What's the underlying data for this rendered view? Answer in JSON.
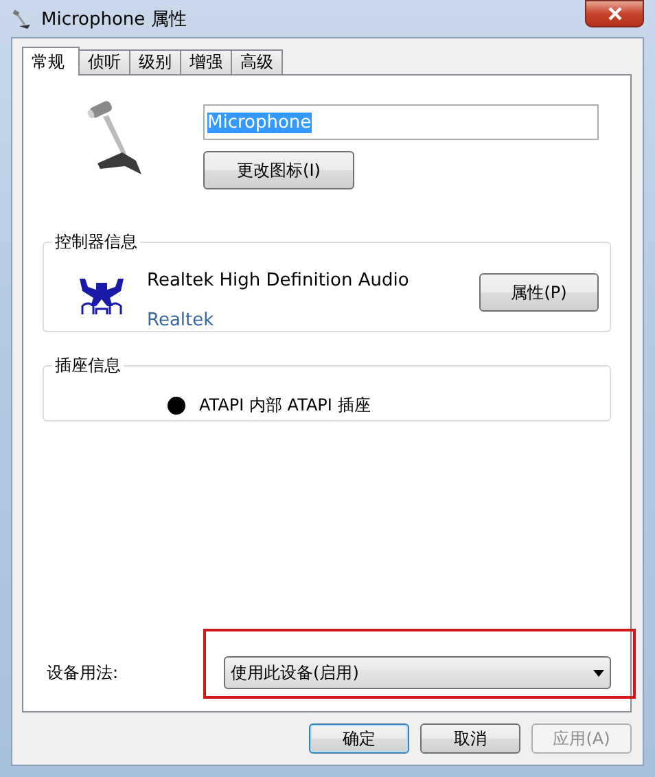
{
  "window": {
    "title": "Microphone 属性"
  },
  "tabs": [
    {
      "label": "常规",
      "selected": true
    },
    {
      "label": "侦听",
      "selected": false
    },
    {
      "label": "级别",
      "selected": false
    },
    {
      "label": "增强",
      "selected": false
    },
    {
      "label": "高级",
      "selected": false
    }
  ],
  "name_field": {
    "value": "Microphone",
    "text_selected": true
  },
  "change_icon_button": "更改图标(I)",
  "controller_info": {
    "heading": "控制器信息",
    "device": "Realtek High Definition Audio",
    "vendor_link": "Realtek",
    "properties_button": "属性(P)"
  },
  "jack_info": {
    "heading": "插座信息",
    "jack": "ATAPI 内部 ATAPI 插座"
  },
  "device_usage": {
    "label": "设备用法:",
    "value": "使用此设备(启用)"
  },
  "buttons": [
    {
      "label": "确定",
      "default": true,
      "disabled": false
    },
    {
      "label": "取消",
      "default": false,
      "disabled": false
    },
    {
      "label": "应用(A)",
      "default": false,
      "disabled": true
    }
  ]
}
